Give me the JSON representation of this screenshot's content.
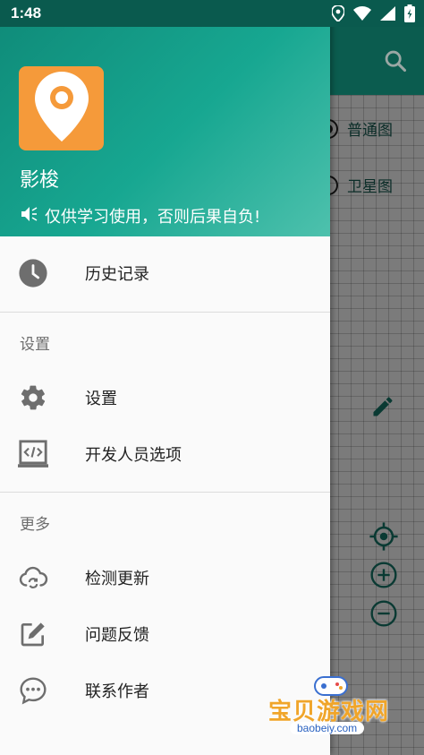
{
  "status_bar": {
    "time": "1:48"
  },
  "drawer": {
    "app_name": "影梭",
    "notice": "仅供学习使用，否则后果自负!",
    "items": {
      "history": "历史记录",
      "settings": "设置",
      "developer": "开发人员选项",
      "check_update": "检测更新",
      "feedback": "问题反馈",
      "contact": "联系作者"
    },
    "sections": {
      "settings": "设置",
      "more": "更多"
    }
  },
  "background": {
    "map_type_normal": "普通图",
    "map_type_satellite": "卫星图"
  },
  "watermark": {
    "text": "宝贝游戏网",
    "url": "baobeiy.com"
  },
  "colors": {
    "header_start": "#0f8a78",
    "header_end": "#4ec1ad",
    "logo_bg": "#f59a3a",
    "toolbar": "#0b5c4f"
  }
}
